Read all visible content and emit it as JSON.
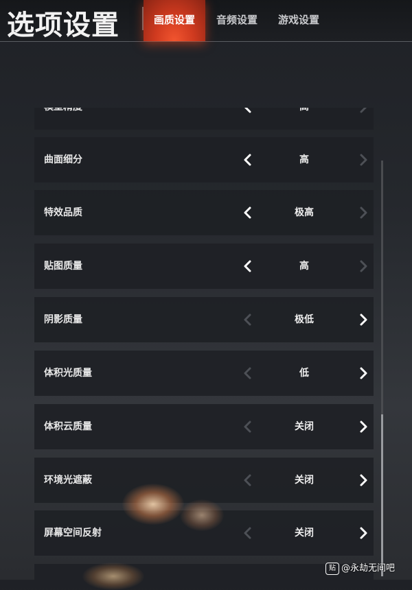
{
  "header": {
    "title": "选项设置",
    "tabs": [
      {
        "label": "画质设置",
        "active": true
      },
      {
        "label": "音频设置",
        "active": false
      },
      {
        "label": "游戏设置",
        "active": false
      }
    ]
  },
  "settings": [
    {
      "label": "模型精度",
      "value": "高",
      "left_enabled": true,
      "right_enabled": false
    },
    {
      "label": "曲面细分",
      "value": "高",
      "left_enabled": true,
      "right_enabled": false
    },
    {
      "label": "特效品质",
      "value": "极高",
      "left_enabled": true,
      "right_enabled": false
    },
    {
      "label": "贴图质量",
      "value": "高",
      "left_enabled": true,
      "right_enabled": false
    },
    {
      "label": "阴影质量",
      "value": "极低",
      "left_enabled": false,
      "right_enabled": true
    },
    {
      "label": "体积光质量",
      "value": "低",
      "left_enabled": false,
      "right_enabled": true
    },
    {
      "label": "体积云质量",
      "value": "关闭",
      "left_enabled": false,
      "right_enabled": true
    },
    {
      "label": "环境光遮蔽",
      "value": "关闭",
      "left_enabled": false,
      "right_enabled": true
    },
    {
      "label": "屏幕空间反射",
      "value": "关闭",
      "left_enabled": false,
      "right_enabled": true
    }
  ],
  "colors": {
    "accent": "#e0452a",
    "arrow_enabled": "#ffffff",
    "arrow_disabled": "#4d5056"
  },
  "watermark": {
    "icon": "贴",
    "text": "@永劫无间吧"
  }
}
